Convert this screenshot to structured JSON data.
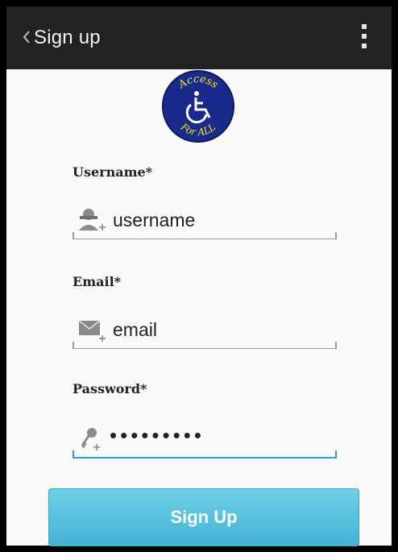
{
  "header": {
    "title": "Sign up",
    "back_icon": "chevron-left-icon",
    "menu_icon": "overflow-menu-icon"
  },
  "logo": {
    "top_text": "Access",
    "bottom_text": "For ALL",
    "icon": "wheelchair-icon",
    "colors": {
      "circle": "#1a2a8a",
      "text": "#f0e32a"
    }
  },
  "form": {
    "username": {
      "label": "Username*",
      "value": "username",
      "icon": "user-add-icon"
    },
    "email": {
      "label": "Email*",
      "value": "email",
      "icon": "envelope-add-icon"
    },
    "password": {
      "label": "Password*",
      "value": "•••••••••",
      "icon": "key-add-icon"
    }
  },
  "actions": {
    "signup_label": "Sign Up"
  },
  "colors": {
    "actionbar": "#222222",
    "accent": "#2aa0d8",
    "button": "#45b3d3"
  }
}
